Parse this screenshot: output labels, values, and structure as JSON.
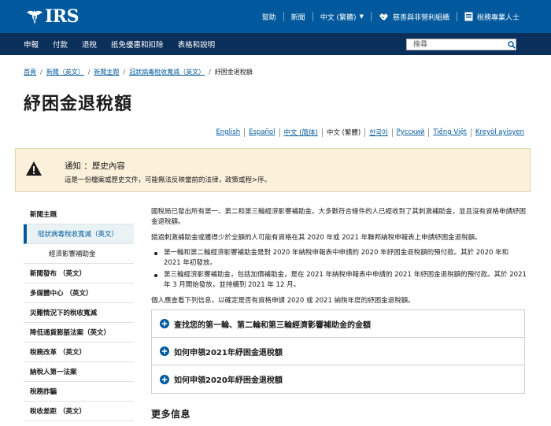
{
  "header": {
    "logo_text": "IRS",
    "utility": [
      {
        "label": "幫助",
        "icon": ""
      },
      {
        "label": "新聞",
        "icon": ""
      },
      {
        "label": "中文 (繁體)",
        "icon": "chevron-down-icon"
      },
      {
        "label": "慈善與非營利組織",
        "icon": "handshake-icon"
      },
      {
        "label": "稅務專業人士",
        "icon": "id-card-icon"
      }
    ],
    "nav": [
      "申報",
      "付款",
      "退稅",
      "抵免優惠和扣除",
      "表格和說明"
    ],
    "search_placeholder": "搜尋"
  },
  "breadcrumb": {
    "items": [
      "首頁",
      "新聞（英文）",
      "新聞主題",
      "冠狀病毒稅收寬減（英文）"
    ],
    "current": "紓困金退稅額"
  },
  "page_title": "紓困金退稅額",
  "languages": [
    {
      "label": "English",
      "current": false
    },
    {
      "label": "Español",
      "current": false
    },
    {
      "label": "中文 (简体)",
      "current": false
    },
    {
      "label": "中文 (繁體)",
      "current": true
    },
    {
      "label": "한국어",
      "current": false
    },
    {
      "label": "Русский",
      "current": false
    },
    {
      "label": "Tiếng Việt",
      "current": false
    },
    {
      "label": "Kreyòl ayisyen",
      "current": false
    }
  ],
  "alert": {
    "title": "通知 ：歷史內容",
    "body": "這是一份檔案或歷史文件，可能無法反映當前的法律，政策或程>序。"
  },
  "sidebar": {
    "items": [
      {
        "label": "新聞主題",
        "level": 0
      },
      {
        "label": "冠狀病毒稅收寬減（英文）",
        "level": 1
      },
      {
        "label": "經濟影響補助金",
        "level": 2
      },
      {
        "label": "新聞發布 （英文）",
        "level": 0
      },
      {
        "label": "多媒體中心 （英文）",
        "level": 0
      },
      {
        "label": "災難情況下的稅收寬減",
        "level": 0
      },
      {
        "label": "降低通貨膨脹法案（英文）",
        "level": 0
      },
      {
        "label": "稅務改革 （英文）",
        "level": 0
      },
      {
        "label": "納稅人第一法案",
        "level": 0
      },
      {
        "label": "稅務詐騙",
        "level": 0
      },
      {
        "label": "稅收差距 （英文）",
        "level": 0
      }
    ]
  },
  "content": {
    "para1": "國稅局已發出所有第一、第二和第三輪經濟影響補助金。大多數符合條件的人已經收到了其刺激補助金，並且沒有資格申請紓困金退稅額。",
    "para2": "錯過刺激補助金或獲得少於全額的人可能有資格在其 2020 年或 2021 年聯邦納稅申報表上申請紓困金退稅額。",
    "bullets": [
      "第一輪和第二輪經濟影響補助金是對 2020 年納稅申報表中申請的 2020 年紓困金退稅額的預付款。其於 2020 年和 2021 年初發放。",
      "第三輪經濟影響補助金，包括加價補助金，是在 2021 年納稅申報表中申請的 2021 年紓困金退稅額的預付款。其於 2021 年 3 月開始發放，並持續到 2021 年 12 月。"
    ],
    "para3": "個人應查看下列信息，以確定是否有資格申請 2020 或 2021 納稅年度的紓困金退稅額。",
    "accordion": [
      "查找您的第一輪、第二輪和第三輪經濟影響補助金的金額",
      "如何申領2021年紓困金退稅額",
      "如何申領2020年紓困金退稅額"
    ],
    "more_info": "更多信息"
  },
  "colors": {
    "header_blue": "#00599c",
    "nav_navy": "#0b2f5b",
    "link_blue": "#00599c",
    "alert_bg": "#fbf0da"
  }
}
